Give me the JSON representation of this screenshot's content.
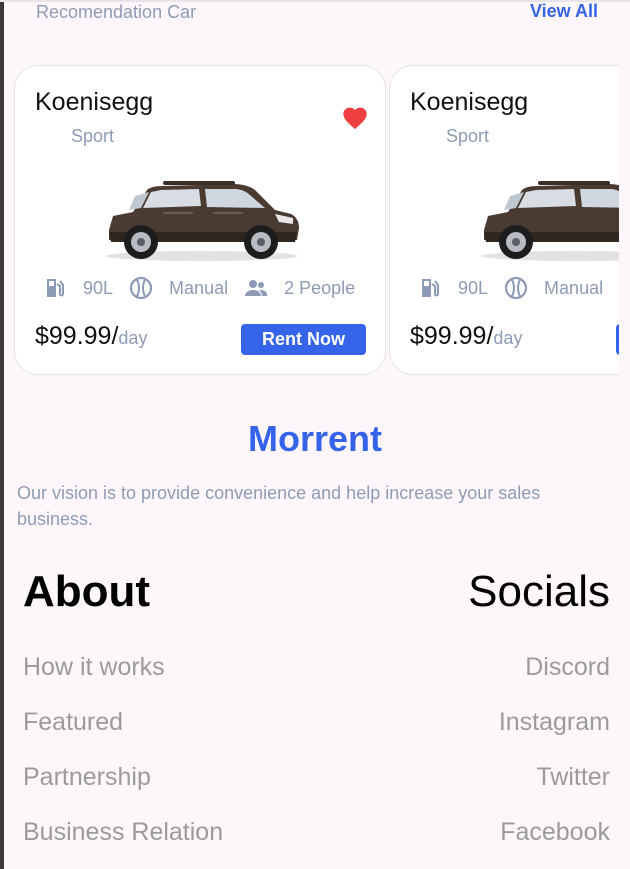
{
  "header": {
    "section_title": "Recomendation Car",
    "view_all": "View All"
  },
  "cards": [
    {
      "name": "Koenisegg",
      "type": "Sport",
      "fuel": "90L",
      "transmission": "Manual",
      "capacity": "2 People",
      "price": "$99.99/",
      "price_unit": "day",
      "cta": "Rent Now",
      "favorite": true
    },
    {
      "name": "Koenisegg",
      "type": "Sport",
      "fuel": "90L",
      "transmission": "Manual",
      "price": "$99.99/",
      "price_unit": "day"
    }
  ],
  "footer": {
    "brand": "Morrent",
    "vision": "Our vision is to provide convenience and help increase your sales business.",
    "about": {
      "title": "About",
      "links": [
        "How it works",
        "Featured",
        "Partnership",
        "Business Relation"
      ]
    },
    "socials": {
      "title": "Socials",
      "links": [
        "Discord",
        "Instagram",
        "Twitter",
        "Facebook"
      ]
    }
  },
  "colors": {
    "accent": "#3563E9",
    "secondary_text": "#8E9BB6",
    "heart": "#ED3F3F",
    "background": "#FDF7FB"
  },
  "icons": [
    "heart-icon",
    "fuel-icon",
    "steering-wheel-icon",
    "people-icon"
  ]
}
